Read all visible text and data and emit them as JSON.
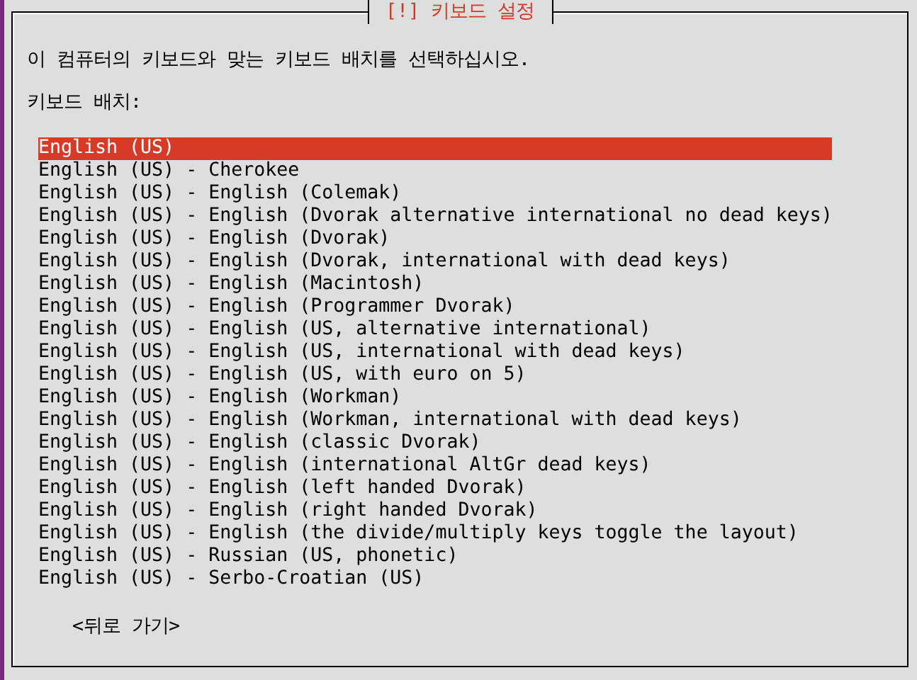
{
  "dialog": {
    "title": "[!] 키보드 설정",
    "prompt": "이 컴퓨터의 키보드와 맞는 키보드 배치를 선택하십시오.",
    "list_label": "키보드 배치:",
    "items": [
      {
        "label": "English (US)",
        "selected": true
      },
      {
        "label": "English (US) - Cherokee",
        "selected": false
      },
      {
        "label": "English (US) - English (Colemak)",
        "selected": false
      },
      {
        "label": "English (US) - English (Dvorak alternative international no dead keys)",
        "selected": false
      },
      {
        "label": "English (US) - English (Dvorak)",
        "selected": false
      },
      {
        "label": "English (US) - English (Dvorak, international with dead keys)",
        "selected": false
      },
      {
        "label": "English (US) - English (Macintosh)",
        "selected": false
      },
      {
        "label": "English (US) - English (Programmer Dvorak)",
        "selected": false
      },
      {
        "label": "English (US) - English (US, alternative international)",
        "selected": false
      },
      {
        "label": "English (US) - English (US, international with dead keys)",
        "selected": false
      },
      {
        "label": "English (US) - English (US, with euro on 5)",
        "selected": false
      },
      {
        "label": "English (US) - English (Workman)",
        "selected": false
      },
      {
        "label": "English (US) - English (Workman, international with dead keys)",
        "selected": false
      },
      {
        "label": "English (US) - English (classic Dvorak)",
        "selected": false
      },
      {
        "label": "English (US) - English (international AltGr dead keys)",
        "selected": false
      },
      {
        "label": "English (US) - English (left handed Dvorak)",
        "selected": false
      },
      {
        "label": "English (US) - English (right handed Dvorak)",
        "selected": false
      },
      {
        "label": "English (US) - English (the divide/multiply keys toggle the layout)",
        "selected": false
      },
      {
        "label": "English (US) - Russian (US, phonetic)",
        "selected": false
      },
      {
        "label": "English (US) - Serbo-Croatian (US)",
        "selected": false
      }
    ],
    "buttons": [
      {
        "label": "<뒤로 가기>"
      }
    ]
  }
}
